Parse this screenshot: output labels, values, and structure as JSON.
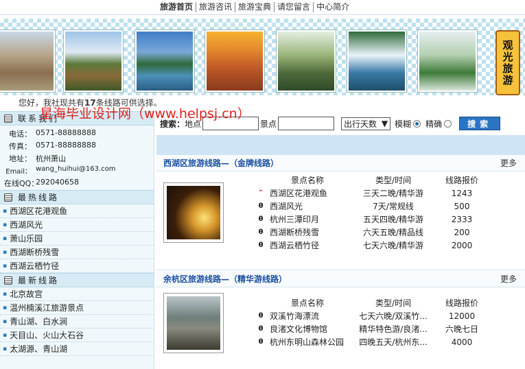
{
  "nav": {
    "items": [
      "旅游首页",
      "旅游咨讯",
      "旅游宝典",
      "请您留言",
      "中心简介"
    ]
  },
  "banner": {
    "slogan": "观光旅游"
  },
  "notice": {
    "prefix": "您好，我社现共有",
    "count": "17",
    "suffix": "条线路可供选择。"
  },
  "watermark": "星海毕业设计网（www.helpsj.cn）",
  "contact": {
    "title": "联系我们",
    "rows": [
      {
        "k": "电话：",
        "v": "0571-88888888"
      },
      {
        "k": "传真：",
        "v": "0571-88888888"
      },
      {
        "k": "地址：",
        "v": "杭州萧山"
      },
      {
        "k": "Email：",
        "v": "wang_huihui@163.com"
      },
      {
        "k": "在线QQ：",
        "v": "292040658"
      }
    ]
  },
  "hot": {
    "title": "最热线路",
    "items": [
      "西湖区花港观鱼",
      "西湖风光",
      "萧山乐园",
      "西湖断桥残雪",
      "西湖云栖竹径"
    ]
  },
  "latest": {
    "title": "最新线路",
    "items": [
      "北京故宫",
      "温州楠溪江旅游景点",
      "青山湖、白水涧",
      "天目山、火山大石谷",
      "太湖源、青山湖"
    ]
  },
  "search": {
    "label_main": "搜索：",
    "label_place": "地点",
    "label_spot": "景点",
    "days_select": "出行天数",
    "fuzzy": "模糊",
    "exact": "精确",
    "button": "搜索"
  },
  "table_headers": {
    "name": "景点名称",
    "type": "类型/时间",
    "price": "线路报价"
  },
  "block1": {
    "title": "西湖区旅游线路—（金牌线路）",
    "more": "更多",
    "rows": [
      {
        "name": "西湖区花港观鱼",
        "type": "三天二晚/精华游",
        "price": "1243",
        "icon": "hot"
      },
      {
        "name": "西湖风光",
        "type": "7天/常规线",
        "price": "500",
        "icon": "normal"
      },
      {
        "name": "杭州三潭印月",
        "type": "五天四晚/精华游",
        "price": "2333",
        "icon": "normal"
      },
      {
        "name": "西湖断桥残雪",
        "type": "六天五晚/精品线",
        "price": "200",
        "icon": "normal"
      },
      {
        "name": "西湖云栖竹径",
        "type": "七天六晚/精华游",
        "price": "2000",
        "icon": "normal"
      }
    ]
  },
  "block2": {
    "title": "余杭区旅游线路—（精华游线路）",
    "more": "更多",
    "rows": [
      {
        "name": "双溪竹海漂流",
        "type": "七天六晚/双溪竹...",
        "price": "12000",
        "icon": "normal"
      },
      {
        "name": "良渚文化博物馆",
        "type": "精华特色游/良渚...",
        "price": "六晚七日",
        "icon": "normal"
      },
      {
        "name": "杭州东明山森林公园",
        "type": "四晚五天/杭州东...",
        "price": "4000",
        "icon": "normal"
      }
    ]
  },
  "colors": {
    "accent": "#2a74c4",
    "title_blue": "#1a4fa0",
    "watermark_red": "#e0201a"
  }
}
